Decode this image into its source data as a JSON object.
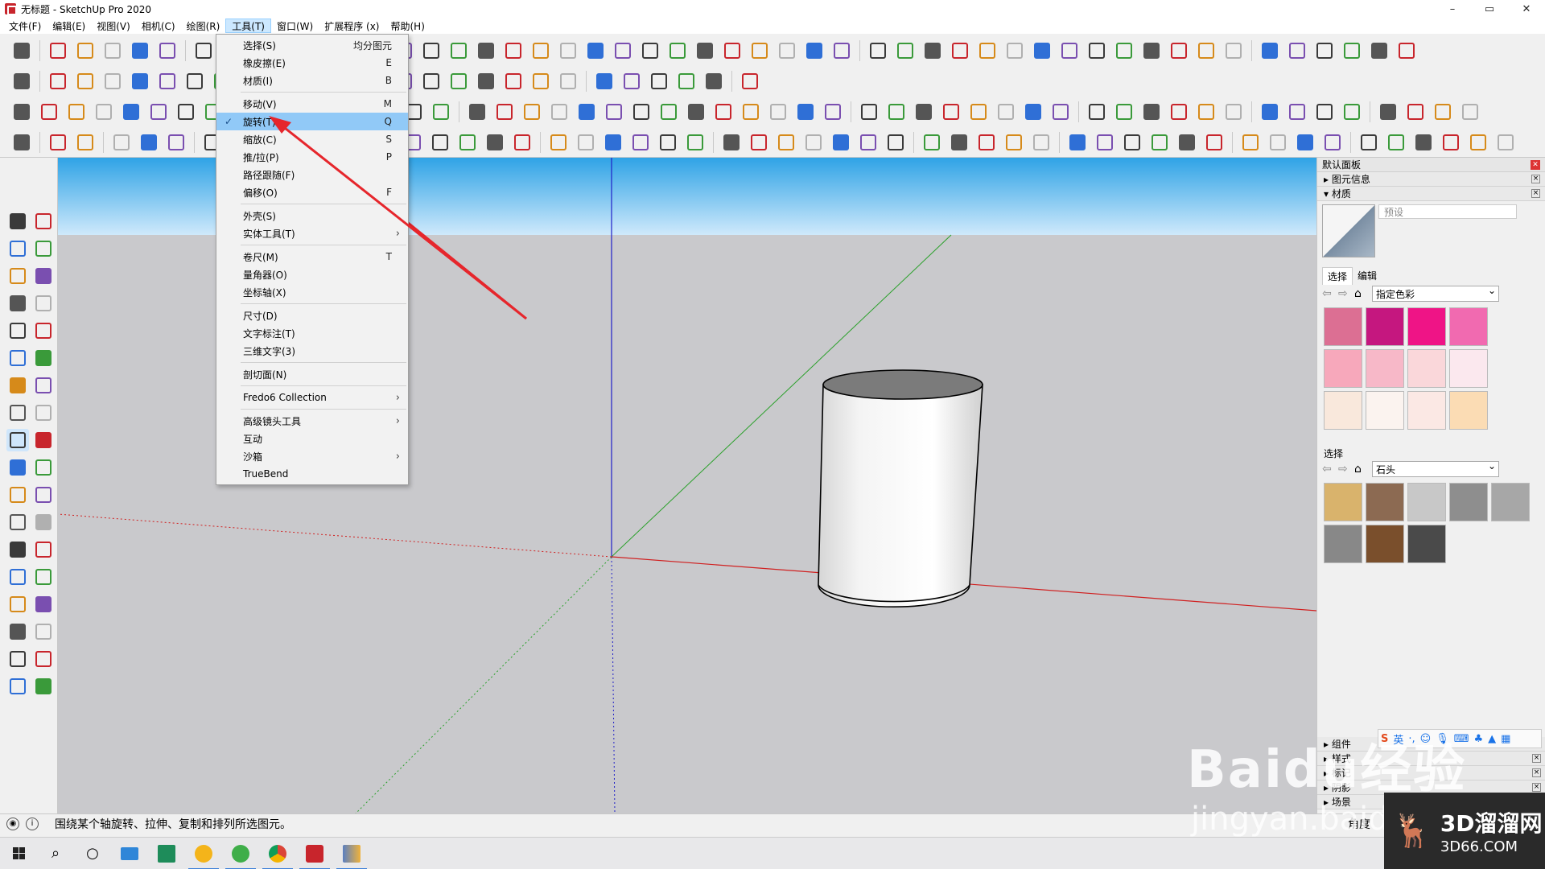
{
  "window": {
    "title": "无标题 - SketchUp Pro 2020",
    "controls": [
      "–",
      "▭",
      "✕"
    ]
  },
  "menubar": [
    "文件(F)",
    "编辑(E)",
    "视图(V)",
    "相机(C)",
    "绘图(R)",
    "工具(T)",
    "窗口(W)",
    "扩展程序 (x)",
    "帮助(H)"
  ],
  "tools_menu": {
    "items": [
      {
        "label": "选择(S)",
        "shortcut": "均分图元"
      },
      {
        "label": "橡皮擦(E)",
        "shortcut": "E"
      },
      {
        "label": "材质(I)",
        "shortcut": "B"
      },
      {
        "label": "移动(V)",
        "shortcut": "M"
      },
      {
        "label": "旋转(T)",
        "shortcut": "Q"
      },
      {
        "label": "缩放(C)",
        "shortcut": "S"
      },
      {
        "label": "推/拉(P)",
        "shortcut": "P"
      },
      {
        "label": "路径跟随(F)",
        "shortcut": ""
      },
      {
        "label": "偏移(O)",
        "shortcut": "F"
      },
      {
        "label": "外壳(S)",
        "shortcut": ""
      },
      {
        "label": "实体工具(T)",
        "shortcut": ""
      },
      {
        "label": "卷尺(M)",
        "shortcut": "T"
      },
      {
        "label": "量角器(O)",
        "shortcut": ""
      },
      {
        "label": "坐标轴(X)",
        "shortcut": ""
      },
      {
        "label": "尺寸(D)",
        "shortcut": ""
      },
      {
        "label": "文字标注(T)",
        "shortcut": ""
      },
      {
        "label": "三维文字(3)",
        "shortcut": ""
      },
      {
        "label": "剖切面(N)",
        "shortcut": ""
      },
      {
        "label": "Fredo6 Collection",
        "shortcut": ""
      },
      {
        "label": "高级镜头工具",
        "shortcut": ""
      },
      {
        "label": "互动",
        "shortcut": ""
      },
      {
        "label": "沙箱",
        "shortcut": ""
      },
      {
        "label": "TrueBend",
        "shortcut": ""
      }
    ],
    "check_mark": "✓",
    "submenu_arrow": "›"
  },
  "tray": {
    "title": "默认面板",
    "panels_top": [
      "图元信息",
      "材质"
    ],
    "material_name_placeholder": "预设",
    "tabs": [
      "选择",
      "编辑"
    ],
    "select1": "指定色彩",
    "select_section_label": "选择",
    "select2": "石头",
    "colors1": [
      "#dc6f93",
      "#c5177f",
      "#ef1486",
      "#f16ab0",
      "#f7a8bb",
      "#f7b8c8",
      "#fad7da",
      "#fbe8ee",
      "#f9e8dc",
      "#fbf3ef",
      "#fbe8e4",
      "#fbdcb4"
    ],
    "colors2": [
      "#d9b36c",
      "#8c6a52",
      "#c8c8c8",
      "#8e8e8e",
      "#a7a7a7",
      "#888888",
      "#7a4f2c",
      "#4a4a4a"
    ],
    "panels_bottom": [
      "组件",
      "样式",
      "标记",
      "阴影",
      "场景"
    ]
  },
  "statusbar": {
    "message": "围绕某个轴旋转、拉伸、复制和排列所选图元。",
    "measure_label": "角度"
  },
  "watermark": {
    "baidu": "Baidu经验",
    "jingyan": "jingyan.baidu",
    "brand_cn": "3D溜溜网",
    "brand_en": "3D66.COM"
  },
  "ime": {
    "lang": "英"
  },
  "colors": {
    "accent": "#c8252c",
    "menu_highlight": "#91c9f7",
    "sky_top": "#2fa3e6",
    "ground": "#c9c9cc",
    "axis_red": "#d02020",
    "axis_green": "#2aa02a",
    "axis_blue": "#2020c8",
    "annotation_arrow": "#e6262c"
  }
}
